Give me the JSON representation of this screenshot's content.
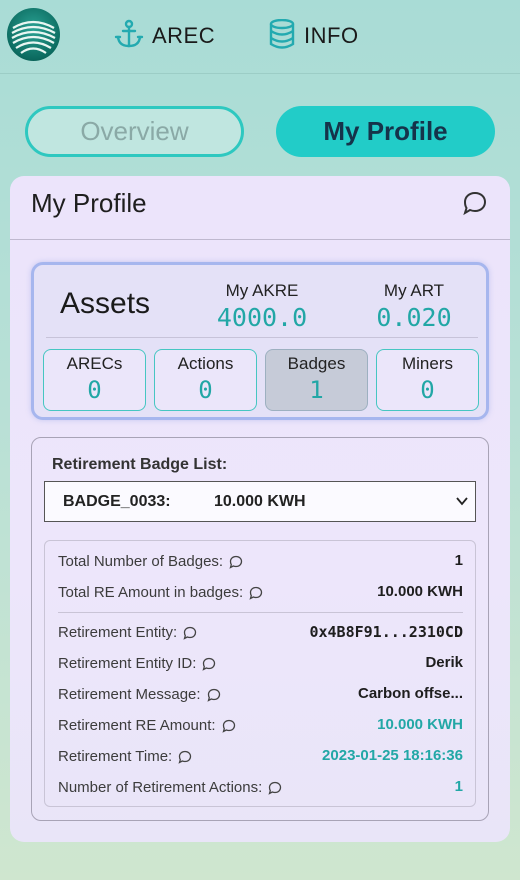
{
  "nav": {
    "items": [
      {
        "label": "AREC",
        "icon": "anchor-icon"
      },
      {
        "label": "INFO",
        "icon": "database-icon"
      }
    ]
  },
  "toggles": {
    "overview": "Overview",
    "my_profile": "My Profile",
    "active": "My Profile"
  },
  "profile": {
    "title": "My Profile",
    "assets": {
      "title": "Assets",
      "akre_label": "My AKRE",
      "akre_value": "4000.0",
      "art_label": "My ART",
      "art_value": "0.020",
      "stats": [
        {
          "label": "ARECs",
          "value": "0"
        },
        {
          "label": "Actions",
          "value": "0"
        },
        {
          "label": "Badges",
          "value": "1"
        },
        {
          "label": "Miners",
          "value": "0"
        }
      ],
      "selected_stat": "Badges"
    },
    "badge_list": {
      "label": "Retirement Badge List:",
      "selected_id": "BADGE_0033:",
      "selected_amount": "10.000 KWH"
    },
    "details": {
      "total_badges_label": "Total Number of Badges:",
      "total_badges_value": "1",
      "total_re_label": "Total RE Amount in badges:",
      "total_re_value": "10.000 KWH",
      "entity_label": "Retirement Entity:",
      "entity_value": "0x4B8F91...2310CD",
      "entity_id_label": "Retirement Entity ID:",
      "entity_id_value": "Derik",
      "message_label": "Retirement Message:",
      "message_value": "Carbon offse...",
      "re_amount_label": "Retirement RE Amount:",
      "re_amount_value": "10.000 KWH",
      "time_label": "Retirement Time:",
      "time_value": "2023-01-25 18:16:36",
      "actions_label": "Number of Retirement Actions:",
      "actions_value": "1"
    }
  },
  "colors": {
    "accent": "#22ccc8",
    "teal_text": "#22a7a6",
    "card_bg": "#ece4fb"
  }
}
